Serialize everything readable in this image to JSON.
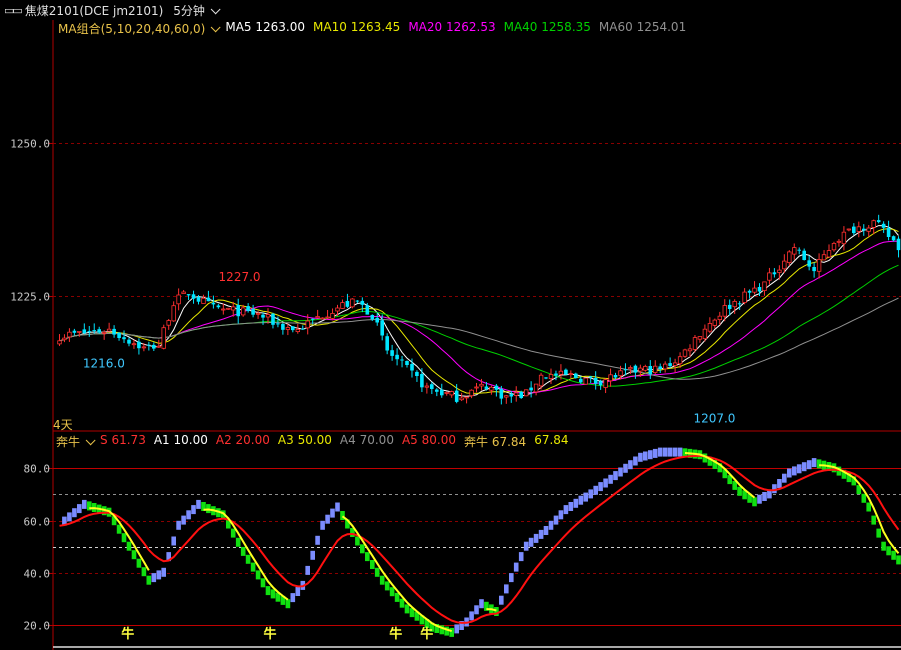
{
  "titlebar": {
    "window_icon": "window-restore-icon",
    "symbol": "焦煤2101(DCE jm2101)",
    "period": "5分钟"
  },
  "main_panel": {
    "legend": {
      "group_label": "MA组合(5,10,20,40,60,0)",
      "items": [
        {
          "label": "MA5",
          "value": "1263.00",
          "color": "#ffffff"
        },
        {
          "label": "MA10",
          "value": "1263.45",
          "color": "#e8e800"
        },
        {
          "label": "MA20",
          "value": "1262.53",
          "color": "#ff00ff"
        },
        {
          "label": "MA40",
          "value": "1258.35",
          "color": "#00d000"
        },
        {
          "label": "MA60",
          "value": "1254.01",
          "color": "#909090"
        }
      ]
    },
    "y_axis": {
      "ticks": [
        {
          "value": 1250,
          "label": "1250.0"
        },
        {
          "value": 1225,
          "label": "1225.0"
        }
      ],
      "min": 1203,
      "max": 1270
    },
    "annotations": [
      {
        "text": "1227.0",
        "price": 1227.0,
        "color": "#ff3030"
      },
      {
        "text": "1216.0",
        "price": 1216.0,
        "color": "#40c8ff"
      },
      {
        "text": "1207.0",
        "price": 1207.0,
        "color": "#40c8ff"
      }
    ],
    "range_label": "4天"
  },
  "sub_panel": {
    "legend": {
      "name": "奔牛",
      "items": [
        {
          "label": "S",
          "value": "61.73",
          "color": "#ff3030"
        },
        {
          "label": "A1",
          "value": "10.00",
          "color": "#ffffff"
        },
        {
          "label": "A2",
          "value": "20.00",
          "color": "#ff3030"
        },
        {
          "label": "A3",
          "value": "50.00",
          "color": "#e8e800"
        },
        {
          "label": "A4",
          "value": "70.00",
          "color": "#909090"
        },
        {
          "label": "A5",
          "value": "80.00",
          "color": "#ff3030"
        },
        {
          "label": "奔牛",
          "value": "67.84",
          "color": "#e8c24a"
        },
        {
          "label": "",
          "value": "67.84",
          "color": "#e8e800"
        }
      ]
    },
    "y_axis": {
      "ticks": [
        {
          "value": 80,
          "label": "80.0"
        },
        {
          "value": 60,
          "label": "60.0"
        },
        {
          "value": 40,
          "label": "40.0"
        },
        {
          "value": 20,
          "label": "20.0"
        }
      ],
      "min": 12,
      "max": 87
    },
    "signal_label": "牛",
    "signal_positions": [
      0.205,
      0.595,
      0.94,
      1.025
    ]
  },
  "colors": {
    "up": "#ff3030",
    "down": "#00e5ff",
    "grid_red": "#8a0000",
    "axis_red": "#b00000",
    "axis_label": "#c8c8c8",
    "bar_rise": "#7b8cff",
    "bar_fall": "#10e010",
    "s_line": "#ff1010",
    "k_line": "#ffff20"
  }
}
